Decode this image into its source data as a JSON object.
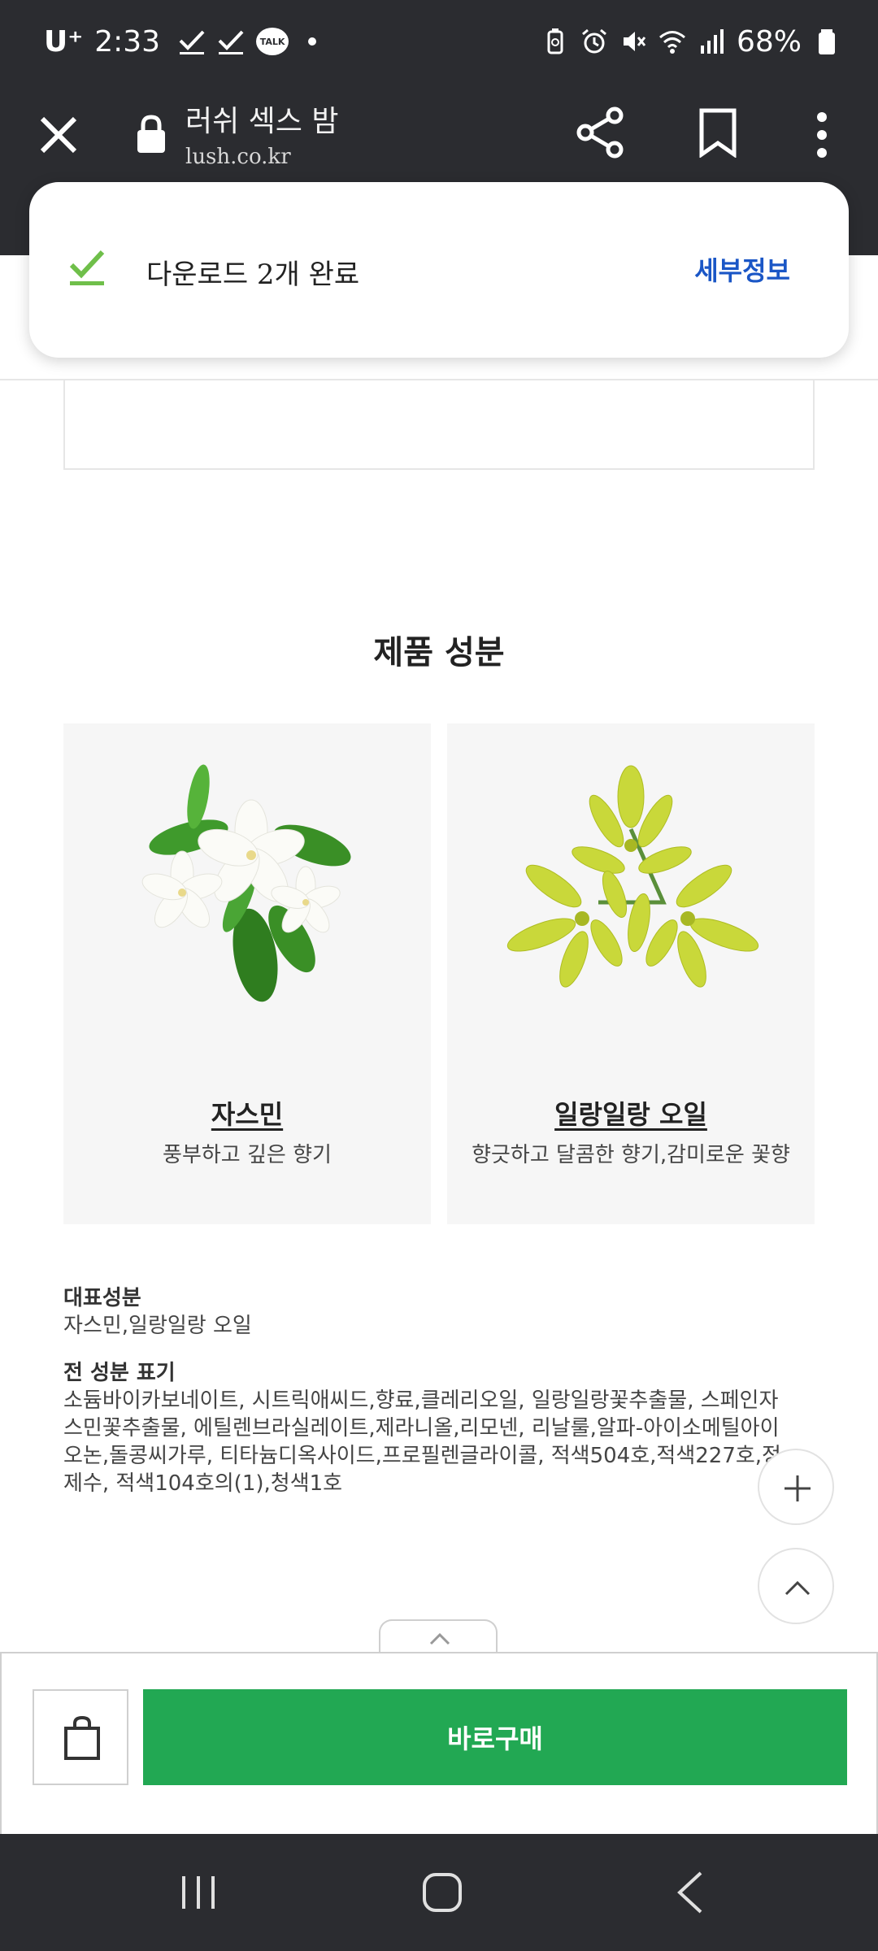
{
  "status_bar": {
    "carrier": "U⁺",
    "time": "2:33",
    "talk_badge": "TALK",
    "battery": "68%"
  },
  "browser": {
    "title": "러쉬 섹스 밤",
    "url": "lush.co.kr"
  },
  "download_popup": {
    "message": "다운로드 2개 완료",
    "details_label": "세부정보",
    "accent_color": "#6fbf4a"
  },
  "section_title": "제품 성분",
  "ingredients": [
    {
      "name": "자스민",
      "description": "풍부하고 깊은 향기"
    },
    {
      "name": "일랑일랑 오일",
      "description": "향긋하고 달콤한 향기,감미로운 꽃향"
    }
  ],
  "key_ingredients": {
    "heading": "대표성분",
    "text": "자스민,일랑일랑 오일"
  },
  "full_ingredients": {
    "heading": "전 성분 표기",
    "text": "소듐바이카보네이트, 시트릭애씨드,향료,클레리오일, 일랑일랑꽃추출물, 스페인자스민꽃추출물, 에틸렌브라실레이트,제라니올,리모넨, 리날룰,알파-아이소메틸아이오논,돌콩씨가루, 티타늄디옥사이드,프로필렌글라이콜, 적색504호,적색227호,정제수, 적색104호의(1),청색1호"
  },
  "buy_bar": {
    "buy_label": "바로구매",
    "buy_color": "#22a853"
  },
  "icons": {
    "close": "close-icon",
    "lock": "lock-icon",
    "share": "share-icon",
    "bookmark": "bookmark-icon",
    "more": "more-vert-icon",
    "plus": "plus-icon",
    "scroll_top": "chevron-up-icon",
    "bag": "shopping-bag-icon"
  }
}
